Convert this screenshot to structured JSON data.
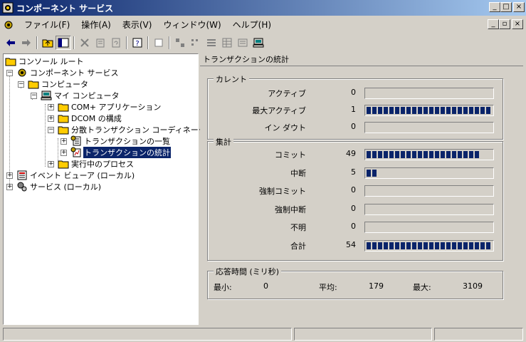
{
  "window": {
    "title": "コンポーネント サービス",
    "caption_buttons": {
      "minimize": "_",
      "maximize": "□",
      "close": "×"
    }
  },
  "menu": {
    "items": [
      "ファイル(F)",
      "操作(A)",
      "表示(V)",
      "ウィンドウ(W)",
      "ヘルプ(H)"
    ],
    "mdi_buttons": {
      "minimize": "_",
      "restore": "▫",
      "close": "×"
    }
  },
  "toolbar": {
    "icons": [
      "back-arrow-icon",
      "forward-arrow-icon",
      "up-folder-icon",
      "show-hide-tree-icon",
      "delete-icon",
      "properties-icon",
      "refresh-icon",
      "help-icon",
      "new-window-icon",
      "large-icons-icon",
      "small-icons-icon",
      "list-icon",
      "detail-icon",
      "view-options-icon",
      "computer-icon"
    ]
  },
  "tree": {
    "items": [
      {
        "label": "コンソール ルート",
        "icon": "folder-icon"
      },
      {
        "label": "コンポーネント サービス",
        "icon": "component-services-icon",
        "expander": "−"
      },
      {
        "label": "コンピュータ",
        "icon": "folder-icon",
        "expander": "−"
      },
      {
        "label": "マイ コンピュータ",
        "icon": "my-computer-icon",
        "expander": "−"
      },
      {
        "label": "COM+ アプリケーション",
        "icon": "folder-icon",
        "expander": "+"
      },
      {
        "label": "DCOM の構成",
        "icon": "folder-icon",
        "expander": "+"
      },
      {
        "label": "分散トランザクション コーディネータ",
        "icon": "folder-icon",
        "expander": "−"
      },
      {
        "label": "トランザクションの一覧",
        "icon": "transaction-list-icon",
        "expander": "+"
      },
      {
        "label": "トランザクションの統計",
        "icon": "transaction-stats-icon",
        "expander": "+",
        "selected": true
      },
      {
        "label": "実行中のプロセス",
        "icon": "folder-icon",
        "expander": "+"
      },
      {
        "label": "イベント ビューア (ローカル)",
        "icon": "event-viewer-icon",
        "expander": "+"
      },
      {
        "label": "サービス (ローカル)",
        "icon": "services-icon",
        "expander": "+"
      }
    ]
  },
  "panel": {
    "header": "トランザクションの統計",
    "current": {
      "title": "カレント",
      "rows": [
        {
          "label": "アクティブ",
          "value": "0",
          "fraction": 0
        },
        {
          "label": "最大アクティブ",
          "value": "1",
          "fraction": 1
        },
        {
          "label": "イン ダウト",
          "value": "0",
          "fraction": 0
        }
      ]
    },
    "aggregate": {
      "title": "集計",
      "rows": [
        {
          "label": "コミット",
          "value": "49",
          "fraction": 0.9
        },
        {
          "label": "中断",
          "value": "5",
          "fraction": 0.09
        },
        {
          "label": "強制コミット",
          "value": "0",
          "fraction": 0
        },
        {
          "label": "強制中断",
          "value": "0",
          "fraction": 0
        },
        {
          "label": "不明",
          "value": "0",
          "fraction": 0
        },
        {
          "label": "合計",
          "value": "54",
          "fraction": 1
        }
      ]
    },
    "response": {
      "title": "応答時間 (ミリ秒)",
      "min_label": "最小:",
      "min_value": "0",
      "avg_label": "平均:",
      "avg_value": "179",
      "max_label": "最大:",
      "max_value": "3109"
    }
  },
  "status": {
    "panes": [
      "",
      "",
      ""
    ]
  },
  "colors": {
    "titlebar_start": "#0a246a",
    "titlebar_end": "#a6caf0",
    "selection": "#0a246a",
    "bar_fill": "#0a246a",
    "face": "#d4d0c8"
  }
}
